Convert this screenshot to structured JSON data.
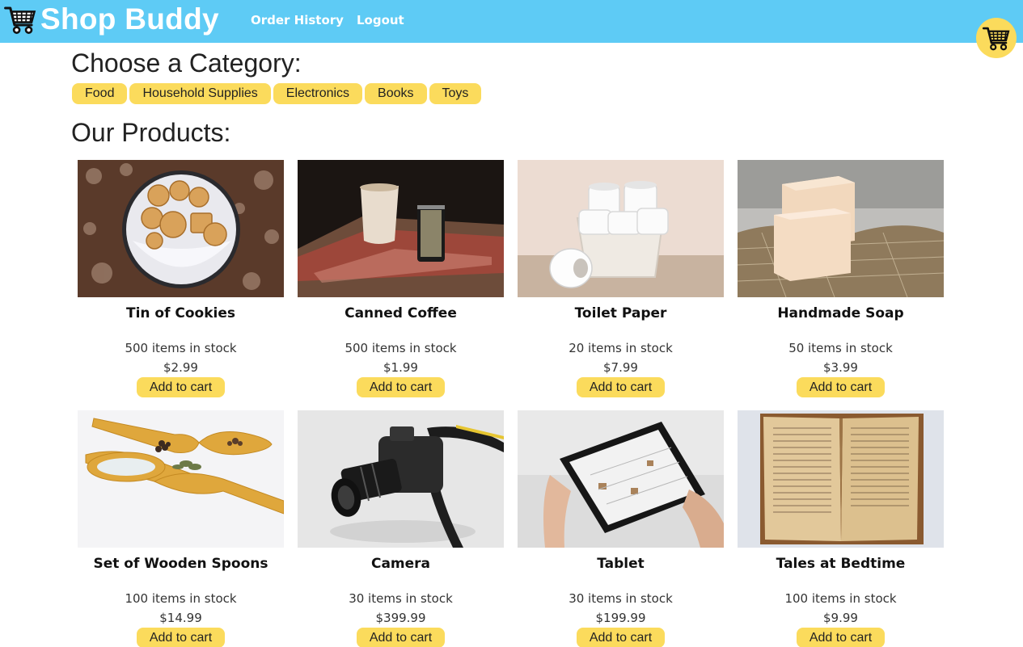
{
  "header": {
    "brand": "Shop Buddy",
    "brand_icon": "shopping-cart-icon",
    "nav": [
      {
        "label": "Order History"
      },
      {
        "label": "Logout"
      }
    ],
    "bg_color": "#5ecbf5",
    "cart_icon": "shopping-cart-icon"
  },
  "categories": {
    "title": "Choose a Category:",
    "items": [
      {
        "label": "Food"
      },
      {
        "label": "Household Supplies"
      },
      {
        "label": "Electronics"
      },
      {
        "label": "Books"
      },
      {
        "label": "Toys"
      }
    ]
  },
  "products": {
    "title": "Our Products:",
    "add_label": "Add to cart",
    "items": [
      {
        "name": "Tin of Cookies",
        "stock": "500 items in stock",
        "price": "$2.99"
      },
      {
        "name": "Canned Coffee",
        "stock": "500 items in stock",
        "price": "$1.99"
      },
      {
        "name": "Toilet Paper",
        "stock": "20 items in stock",
        "price": "$7.99"
      },
      {
        "name": "Handmade Soap",
        "stock": "50 items in stock",
        "price": "$3.99"
      },
      {
        "name": "Set of Wooden Spoons",
        "stock": "100 items in stock",
        "price": "$14.99"
      },
      {
        "name": "Camera",
        "stock": "30 items in stock",
        "price": "$399.99"
      },
      {
        "name": "Tablet",
        "stock": "30 items in stock",
        "price": "$199.99"
      },
      {
        "name": "Tales at Bedtime",
        "stock": "100 items in stock",
        "price": "$9.99"
      }
    ]
  },
  "colors": {
    "accent": "#fbdb5c",
    "header": "#5ecbf5"
  }
}
